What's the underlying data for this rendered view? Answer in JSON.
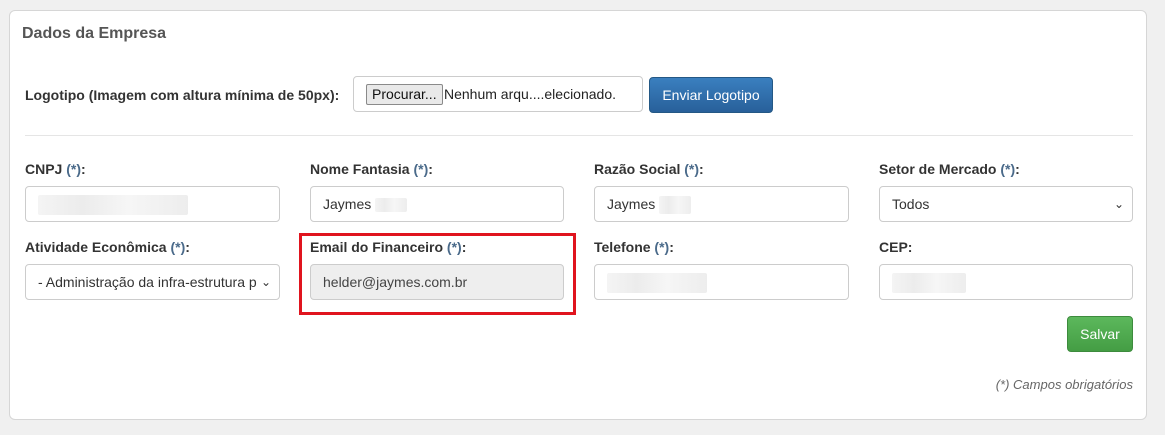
{
  "panel": {
    "title": "Dados da Empresa",
    "logo_label": "Logotipo (Imagem com altura mínima de 50px):",
    "file_button": "Procurar...",
    "file_status": "Nenhum arqu....elecionado.",
    "upload_button": "Enviar Logotipo"
  },
  "fields": {
    "cnpj": {
      "label": "CNPJ",
      "req": "(*)",
      "colon": ":",
      "value": ""
    },
    "nome_fantasia": {
      "label": "Nome Fantasia",
      "req": "(*)",
      "colon": ":",
      "value": "Jaymes"
    },
    "razao_social": {
      "label": "Razão Social",
      "req": "(*)",
      "colon": ":",
      "value": "Jaymes"
    },
    "setor": {
      "label": "Setor de Mercado",
      "req": "(*)",
      "colon": ":",
      "value": "Todos"
    },
    "atividade": {
      "label": "Atividade Econômica",
      "req": "(*)",
      "colon": ":",
      "value": "- Administração da infra-estrutura p"
    },
    "email": {
      "label": "Email do Financeiro",
      "req": "(*)",
      "colon": ":",
      "value": "helder@jaymes.com.br"
    },
    "telefone": {
      "label": "Telefone",
      "req": "(*)",
      "colon": ":",
      "value": ""
    },
    "cep": {
      "label": "CEP",
      "req": "",
      "colon": ":",
      "value": ""
    }
  },
  "actions": {
    "save": "Salvar"
  },
  "footer_note": "(*) Campos obrigatórios",
  "colors": {
    "primary": "#2e6da4",
    "success": "#5cb85c",
    "highlight": "#e0141e"
  }
}
